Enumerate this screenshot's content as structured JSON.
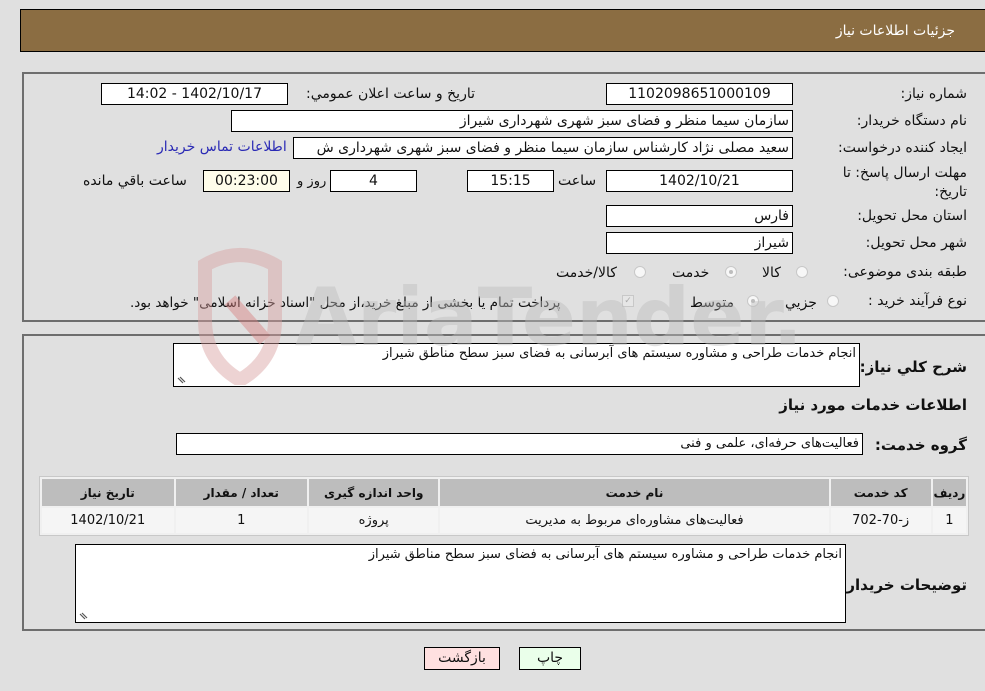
{
  "header": {
    "title": "جزئیات اطلاعات نیاز"
  },
  "fields": {
    "need_number_label": "شماره نیاز:",
    "need_number": "1102098651000109",
    "announce_label": "تاریخ و ساعت اعلان عمومي:",
    "announce_value": "1402/10/17 - 14:02",
    "buyer_org_label": "نام دستگاه خریدار:",
    "buyer_org": "سازمان سیما منظر و فضای سبز شهری شهرداری شیراز",
    "requester_label": "ایجاد کننده درخواست:",
    "requester": "سعید مصلی نژاد کارشناس سازمان سیما منظر و فضای سبز شهری شهرداری ش",
    "contact_link": "اطلاعات تماس خریدار",
    "deadline_label": "مهلت ارسال پاسخ: تا تاریخ:",
    "deadline_date": "1402/10/21",
    "time_label": "ساعت",
    "deadline_time": "15:15",
    "days_value": "4",
    "days_label": "روز و",
    "remaining_time": "00:23:00",
    "remaining_label": "ساعت باقي مانده",
    "province_label": "استان محل تحویل:",
    "province": "فارس",
    "city_label": "شهر محل تحویل:",
    "city": "شیراز",
    "category_label": "طبقه بندی موضوعی:",
    "category_options": [
      "کالا",
      "خدمت",
      "کالا/خدمت"
    ],
    "category_selected": "خدمت",
    "process_label": "نوع فرآیند خرید :",
    "process_options": [
      "جزیي",
      "متوسط"
    ],
    "process_selected": "متوسط",
    "treasury_note": "پرداخت تمام یا بخشی از مبلغ خرید،از محل \"اسناد خزانه اسلامی\" خواهد بود."
  },
  "description": {
    "label": "شرح کلي نیاز:",
    "value": "انجام خدمات طراحی و مشاوره سیستم های آبرسانی به فضای سبز سطح مناطق شیراز"
  },
  "services": {
    "section_title": "اطلاعات خدمات مورد نیاز",
    "group_label": "گروه خدمت:",
    "group_value": "فعالیت‌های حرفه‌ای، علمی و فنی",
    "columns": [
      "ردیف",
      "کد خدمت",
      "نام خدمت",
      "واحد اندازه گیری",
      "تعداد / مقدار",
      "تاریخ نیاز"
    ],
    "rows": [
      [
        "1",
        "ز-70-702",
        "فعالیت‌های مشاوره‌ای مربوط به مدیریت",
        "پروژه",
        "1",
        "1402/10/21"
      ]
    ]
  },
  "buyer_notes": {
    "label": "توضیحات خریدار:",
    "value": "انجام خدمات طراحی و مشاوره سیستم های آبرسانی به فضای سبز سطح مناطق شیراز"
  },
  "buttons": {
    "print": "چاپ",
    "back": "بازگشت"
  },
  "watermark": {
    "text": "AriaTender.neT"
  },
  "colors": {
    "header_bg": "#8b6d42",
    "print_bg": "#eaffea",
    "back_bg": "#ffe0e0",
    "link": "#2a2ab5"
  }
}
